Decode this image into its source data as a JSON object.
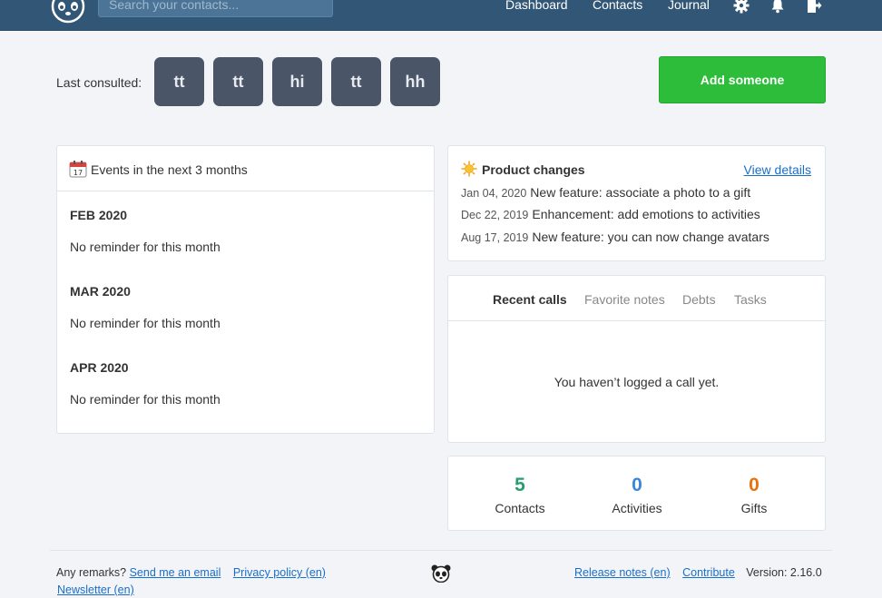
{
  "header": {
    "search_placeholder": "Search your contacts...",
    "nav": [
      "Dashboard",
      "Contacts",
      "Journal"
    ],
    "icons": [
      "gear-icon",
      "bell-icon",
      "logout-icon"
    ]
  },
  "last_consulted": {
    "label": "Last consulted:",
    "contacts": [
      "tt",
      "tt",
      "hi",
      "tt",
      "hh"
    ]
  },
  "add_button": "Add someone",
  "events": {
    "title": "Events in the next 3 months",
    "months": [
      {
        "name": "FEB 2020",
        "text": "No reminder for this month"
      },
      {
        "name": "MAR 2020",
        "text": "No reminder for this month"
      },
      {
        "name": "APR 2020",
        "text": "No reminder for this month"
      }
    ]
  },
  "product_changes": {
    "title": "Product changes",
    "view_details": "View details",
    "items": [
      {
        "date": "Jan 04, 2020",
        "text": "New feature: associate a photo to a gift"
      },
      {
        "date": "Dec 22, 2019",
        "text": "Enhancement: add emotions to activities"
      },
      {
        "date": "Aug 17, 2019",
        "text": "New feature: you can now change avatars"
      }
    ]
  },
  "tabs": {
    "items": [
      "Recent calls",
      "Favorite notes",
      "Debts",
      "Tasks"
    ],
    "active": "Recent calls",
    "empty_message": "You haven’t logged a call yet."
  },
  "stats": [
    {
      "value": "5",
      "label": "Contacts",
      "color": "#2a9d6f"
    },
    {
      "value": "0",
      "label": "Activities",
      "color": "#3a86d8"
    },
    {
      "value": "0",
      "label": "Gifts",
      "color": "#e8720c"
    }
  ],
  "footer": {
    "remarks": "Any remarks?",
    "send_email": "Send me an email",
    "privacy": "Privacy policy (en)",
    "newsletter": "Newsletter (en)",
    "release_notes": "Release notes (en)",
    "contribute": "Contribute",
    "version": "Version: 2.16.0"
  },
  "colors": {
    "header_bg": "#325776",
    "tile_bg": "#4a5568",
    "add_button_bg": "#2dbd3a",
    "link": "#1a6fc9"
  }
}
